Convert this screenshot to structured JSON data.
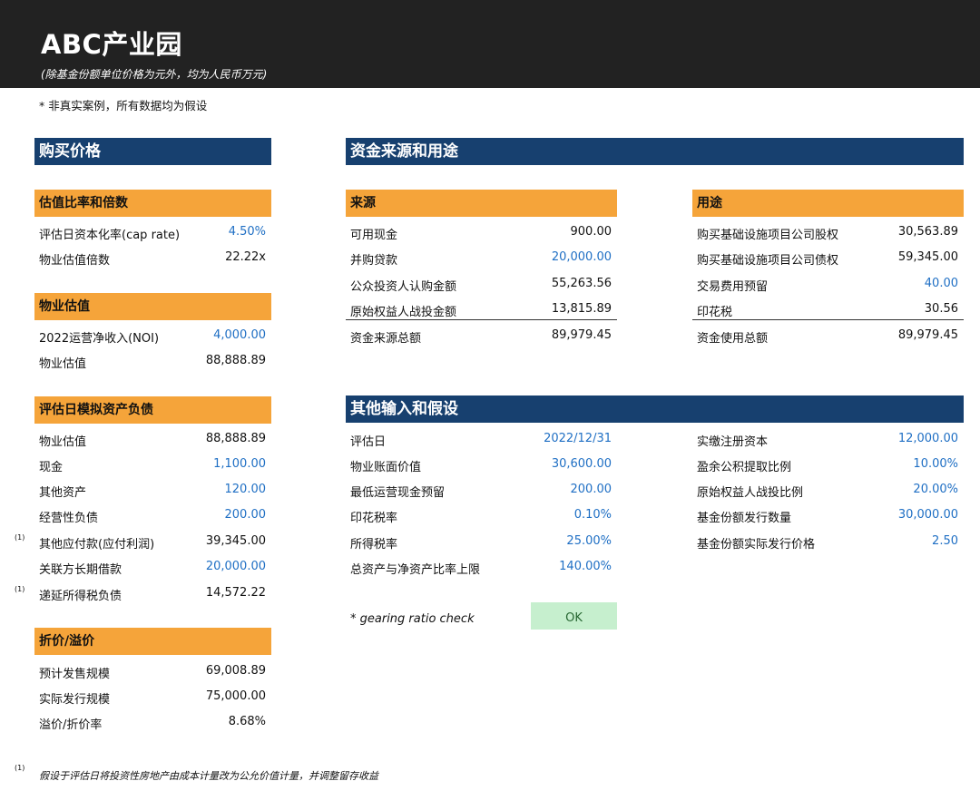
{
  "header": {
    "title": "ABC产业园",
    "subtitle": "(除基金份额单位价格为元外，均为人民币万元)",
    "disclaimer": "* 非真实案例，所有数据均为假设"
  },
  "purchase": {
    "title": "购买价格",
    "valuation_ratio": {
      "title": "估值比率和倍数",
      "rows": [
        {
          "label": "评估日资本化率(cap rate)",
          "value": "4.50%"
        },
        {
          "label": "物业估值倍数",
          "value": "22.22x"
        }
      ]
    },
    "property_valuation": {
      "title": "物业估值",
      "rows": [
        {
          "label": "2022运营净收入(NOI)",
          "value": "4,000.00"
        },
        {
          "label": "物业估值",
          "value": "88,888.89"
        }
      ]
    },
    "balance_sheet": {
      "title": "评估日模拟资产负债",
      "rows": [
        {
          "label": "物业估值",
          "value": "88,888.89"
        },
        {
          "label": "现金",
          "value": "1,100.00"
        },
        {
          "label": "其他资产",
          "value": "120.00"
        },
        {
          "label": "经营性负债",
          "value": "200.00"
        },
        {
          "label": "其他应付款(应付利润)",
          "value": "39,345.00",
          "note": "(1)"
        },
        {
          "label": "关联方长期借款",
          "value": "20,000.00"
        },
        {
          "label": "递延所得税负债",
          "value": "14,572.22",
          "note": "(1)"
        }
      ]
    },
    "discount": {
      "title": "折价/溢价",
      "rows": [
        {
          "label": "预计发售规模",
          "value": "69,008.89"
        },
        {
          "label": "实际发行规模",
          "value": "75,000.00"
        },
        {
          "label": "溢价/折价率",
          "value": "8.68%"
        }
      ]
    }
  },
  "funds": {
    "title": "资金来源和用途",
    "sources": {
      "title": "来源",
      "rows": [
        {
          "label": "可用现金",
          "value": "900.00"
        },
        {
          "label": "并购贷款",
          "value": "20,000.00"
        },
        {
          "label": "公众投资人认购金额",
          "value": "55,263.56"
        },
        {
          "label": "原始权益人战投金额",
          "value": "13,815.89"
        }
      ],
      "total": {
        "label": "资金来源总额",
        "value": "89,979.45"
      }
    },
    "uses": {
      "title": "用途",
      "rows": [
        {
          "label": "购买基础设施项目公司股权",
          "value": "30,563.89"
        },
        {
          "label": "购买基础设施项目公司债权",
          "value": "59,345.00"
        },
        {
          "label": "交易费用预留",
          "value": "40.00"
        },
        {
          "label": "印花税",
          "value": "30.56"
        }
      ],
      "total": {
        "label": "资金使用总额",
        "value": "89,979.45"
      }
    }
  },
  "other": {
    "title": "其他输入和假设",
    "left_rows": [
      {
        "label": "评估日",
        "value": "2022/12/31"
      },
      {
        "label": "物业账面价值",
        "value": "30,600.00"
      },
      {
        "label": "最低运营现金预留",
        "value": "200.00"
      },
      {
        "label": "印花税率",
        "value": "0.10%"
      },
      {
        "label": "所得税率",
        "value": "25.00%"
      },
      {
        "label": "总资产与净资产比率上限",
        "value": "140.00%"
      }
    ],
    "right_rows": [
      {
        "label": "实缴注册资本",
        "value": "12,000.00"
      },
      {
        "label": "盈余公积提取比例",
        "value": "10.00%"
      },
      {
        "label": "原始权益人战投比例",
        "value": "20.00%"
      },
      {
        "label": "基金份额发行数量",
        "value": "30,000.00"
      },
      {
        "label": "基金份额实际发行价格",
        "value": "2.50"
      }
    ],
    "gearing_label": "* gearing ratio check",
    "gearing_status": "OK"
  },
  "footnote": {
    "mark": "(1)",
    "text": "假设于评估日将投资性房地产由成本计量改为公允价值计量，并调整留存收益"
  },
  "colors": {
    "header_bg": "#222222",
    "section_blue": "#17406f",
    "subsection_orange": "#f5a43a",
    "input_blue": "#1f6fc4",
    "ok_green": "#c6efce"
  }
}
